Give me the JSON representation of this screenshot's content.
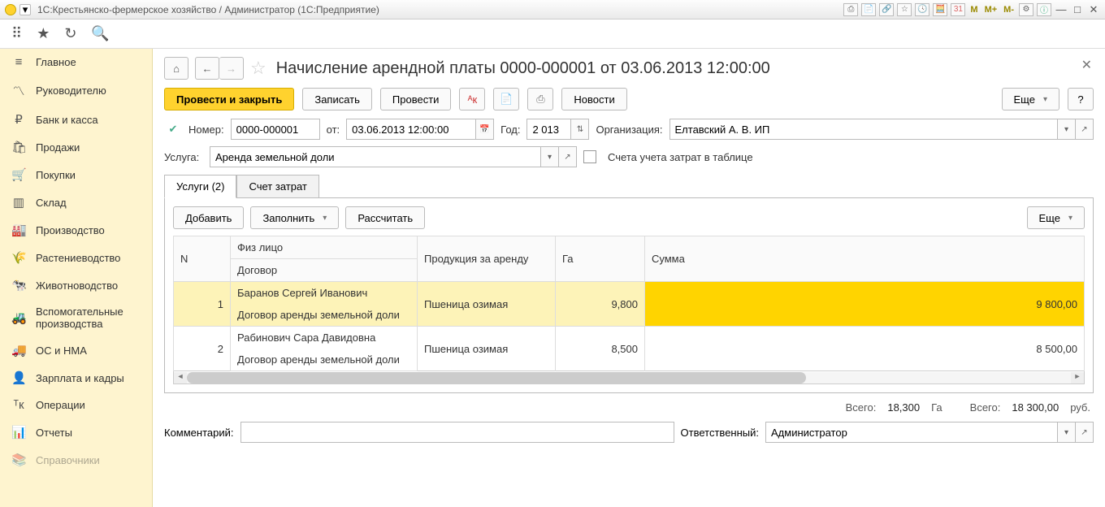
{
  "window": {
    "title": "1С:Крестьянско-фермерское хозяйство / Администратор  (1С:Предприятие)"
  },
  "toolbar_icons": {
    "m1": "M",
    "m2": "M+",
    "m3": "M-"
  },
  "sidebar": {
    "items": [
      {
        "icon": "≡",
        "label": "Главное"
      },
      {
        "icon": "〽",
        "label": "Руководителю"
      },
      {
        "icon": "₽",
        "label": "Банк и касса"
      },
      {
        "icon": "🛍",
        "label": "Продажи"
      },
      {
        "icon": "🛒",
        "label": "Покупки"
      },
      {
        "icon": "▥",
        "label": "Склад"
      },
      {
        "icon": "🏭",
        "label": "Производство"
      },
      {
        "icon": "🌾",
        "label": "Растениеводство"
      },
      {
        "icon": "🐄",
        "label": "Животноводство"
      },
      {
        "icon": "🚜",
        "label": "Вспомогательные производства"
      },
      {
        "icon": "🚚",
        "label": "ОС и НМА"
      },
      {
        "icon": "👤",
        "label": "Зарплата и кадры"
      },
      {
        "icon": "ᵀк",
        "label": "Операции"
      },
      {
        "icon": "📊",
        "label": "Отчеты"
      },
      {
        "icon": "📚",
        "label": "Справочники"
      }
    ]
  },
  "doc": {
    "title": "Начисление арендной платы 0000-000001 от 03.06.2013 12:00:00",
    "number_label": "Номер:",
    "number": "0000-000001",
    "from_label": "от:",
    "date": "03.06.2013 12:00:00",
    "year_label": "Год:",
    "year": "2 013",
    "org_label": "Организация:",
    "org": "Елтавский А. В. ИП",
    "service_label": "Услуга:",
    "service": "Аренда земельной доли",
    "accounts_label": "Счета учета затрат в таблице"
  },
  "actions": {
    "post_close": "Провести и закрыть",
    "save": "Записать",
    "post": "Провести",
    "news": "Новости",
    "more": "Еще",
    "help": "?"
  },
  "tabs": {
    "t1": "Услуги (2)",
    "t2": "Счет затрат"
  },
  "tblbar": {
    "add": "Добавить",
    "fill": "Заполнить",
    "calc": "Рассчитать",
    "more": "Еще"
  },
  "cols": {
    "n": "N",
    "person": "Физ лицо",
    "contract": "Договор",
    "product": "Продукция за аренду",
    "ha": "Га",
    "sum": "Сумма"
  },
  "rows": [
    {
      "n": "1",
      "person": "Баранов Сергей Иванович",
      "contract": "Договор аренды земельной доли",
      "product": "Пшеница озимая",
      "ha": "9,800",
      "sum": "9 800,00"
    },
    {
      "n": "2",
      "person": "Рабинович Сара Давидовна",
      "contract": "Договор аренды земельной доли",
      "product": "Пшеница озимая",
      "ha": "8,500",
      "sum": "8 500,00"
    }
  ],
  "totals": {
    "l1": "Всего:",
    "v1": "18,300",
    "u1": "Га",
    "l2": "Всего:",
    "v2": "18 300,00",
    "u2": "руб."
  },
  "bottom": {
    "comment_label": "Комментарий:",
    "comment": "",
    "resp_label": "Ответственный:",
    "resp": "Администратор"
  }
}
